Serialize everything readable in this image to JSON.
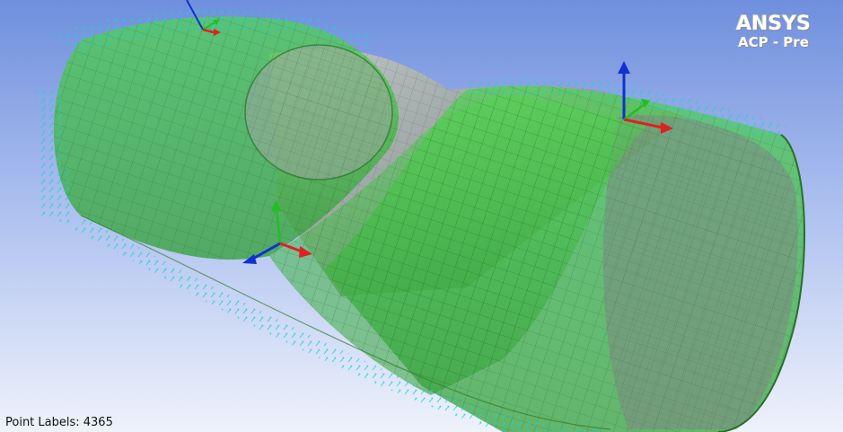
{
  "app": {
    "logo_text": "ANSYS",
    "product_name": "ACP - Pre"
  },
  "status": {
    "point_labels": "Point Labels: 4365"
  },
  "colors": {
    "background_top": "#6f8fdd",
    "background_bottom": "#eef2fb",
    "shell_green": "#3fbf3f",
    "inner_grey": "#8d9a95",
    "normal_arrows": "#1fd0d0",
    "axis_x": "#e02020",
    "axis_y": "#20c020",
    "axis_z": "#1030d0"
  },
  "icons": {
    "coordinate_triad": "xyz-axes-icon"
  }
}
